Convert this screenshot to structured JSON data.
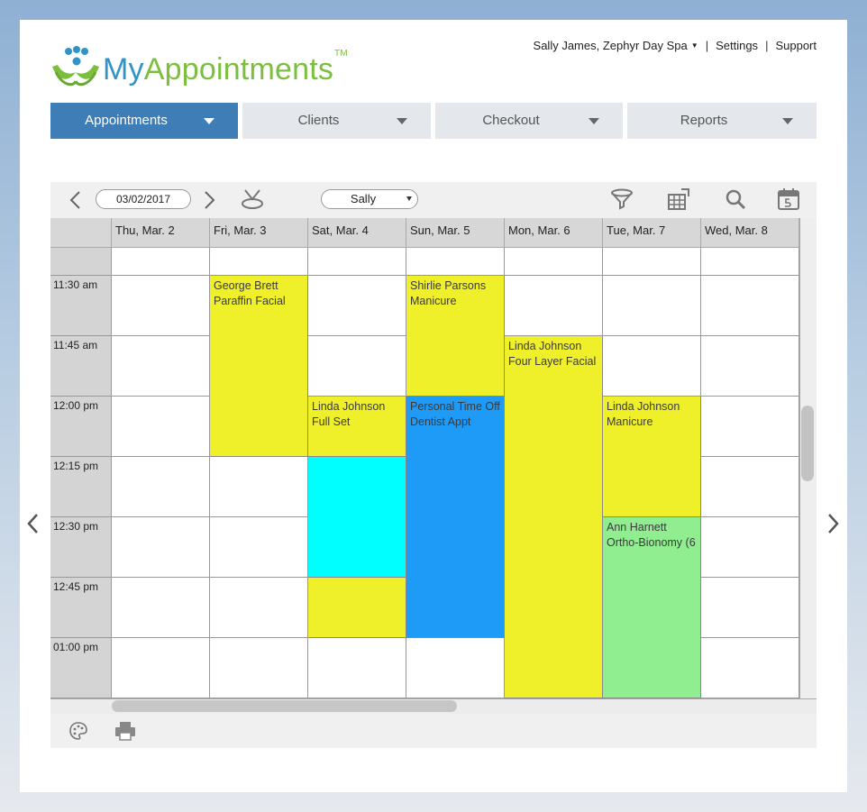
{
  "brand": {
    "name_part1": "My",
    "name_part2": "Appointments",
    "trademark": "TM"
  },
  "top_links": {
    "user": "Sally James, Zephyr Day Spa",
    "settings": "Settings",
    "support": "Support"
  },
  "nav": [
    {
      "label": "Appointments",
      "active": true
    },
    {
      "label": "Clients",
      "active": false
    },
    {
      "label": "Checkout",
      "active": false
    },
    {
      "label": "Reports",
      "active": false
    }
  ],
  "toolbar": {
    "date": "03/02/2017",
    "staff": "Sally"
  },
  "calendar": {
    "days": [
      "Thu, Mar. 2",
      "Fri, Mar. 3",
      "Sat, Mar. 4",
      "Sun, Mar. 5",
      "Mon, Mar. 6",
      "Tue, Mar. 7",
      "Wed, Mar. 8"
    ],
    "times": [
      "11:30 am",
      "11:45 am",
      "12:00 pm",
      "12:15 pm",
      "12:30 pm",
      "12:45 pm",
      "01:00 pm"
    ],
    "appointments": [
      {
        "day": 1,
        "start": 0,
        "slots": 3,
        "line1": "George Brett",
        "line2": "Paraffin Facial",
        "color": "#f0f02a"
      },
      {
        "day": 3,
        "start": 0,
        "slots": 2,
        "line1": "Shirlie Parsons",
        "line2": "Manicure",
        "color": "#f0f02a"
      },
      {
        "day": 4,
        "start": 1,
        "slots": 6,
        "line1": "Linda Johnson",
        "line2": "Four Layer Facial",
        "color": "#f0f02a"
      },
      {
        "day": 2,
        "start": 2,
        "slots": 1,
        "line1": "Linda Johnson",
        "line2": "Full Set",
        "color": "#f0f02a"
      },
      {
        "day": 2,
        "start": 3,
        "slots": 2,
        "line1": "",
        "line2": "",
        "color": "#00ffff"
      },
      {
        "day": 2,
        "start": 5,
        "slots": 1,
        "line1": "",
        "line2": "",
        "color": "#f0f02a"
      },
      {
        "day": 3,
        "start": 2,
        "slots": 4,
        "line1": "Personal Time Off",
        "line2": "Dentist Appt",
        "color": "#1e9af7"
      },
      {
        "day": 5,
        "start": 2,
        "slots": 2,
        "line1": "Linda Johnson",
        "line2": "Manicure",
        "color": "#f0f02a"
      },
      {
        "day": 5,
        "start": 4,
        "slots": 3,
        "line1": "Ann Harnett",
        "line2": "Ortho-Bionomy (6",
        "color": "#90ee90"
      }
    ]
  },
  "colors": {
    "accent": "#3f7db7",
    "brand_blue": "#2f95c9",
    "brand_green": "#7cbf3f"
  }
}
